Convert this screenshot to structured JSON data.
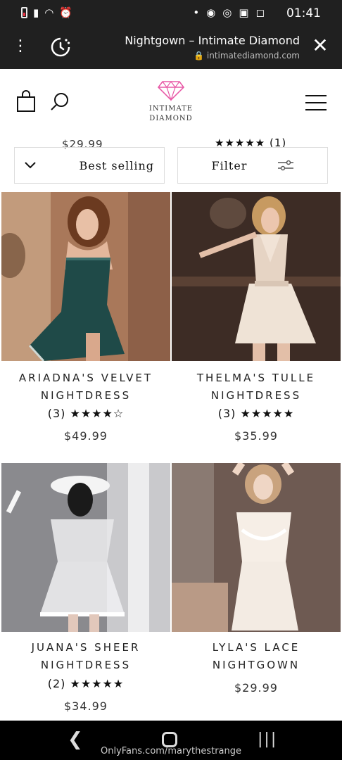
{
  "status_bar": {
    "time": "01:41",
    "dot": "•"
  },
  "browser": {
    "title": "Nightgown – Intimate Diamond",
    "url": "intimatediamond.com",
    "menu_icon": "⋮",
    "close_icon": "✕"
  },
  "site": {
    "logo_line1": "INTIMATE",
    "logo_line2": "DIAMOND",
    "brand_color": "#e85aa7"
  },
  "peek": {
    "price": "$29.99",
    "rating": "★★★★★ (1)"
  },
  "filters": {
    "sort_label": "Best selling",
    "filter_label": "Filter"
  },
  "products": [
    {
      "name_line1": "ARIADNA'S VELVET",
      "name_line2": "NIGHTDRESS",
      "stars": "★★★★☆",
      "reviews": "(3)",
      "price": "$49.99"
    },
    {
      "name_line1": "THELMA'S TULLE",
      "name_line2": "NIGHTDRESS",
      "stars": "★★★★★",
      "reviews": "(3)",
      "price": "$35.99"
    },
    {
      "name_line1": "JUANA'S SHEER",
      "name_line2": "NIGHTDRESS",
      "stars": "★★★★★",
      "reviews": "(2)",
      "price": "$34.99"
    },
    {
      "name_line1": "LYLA'S LACE",
      "name_line2": "NIGHTGOWN",
      "stars": "",
      "reviews": "",
      "price": "$29.99"
    }
  ],
  "nav": {
    "back": "❮",
    "recent": "|||"
  },
  "watermark": "OnlyFans.com/marythestrange"
}
